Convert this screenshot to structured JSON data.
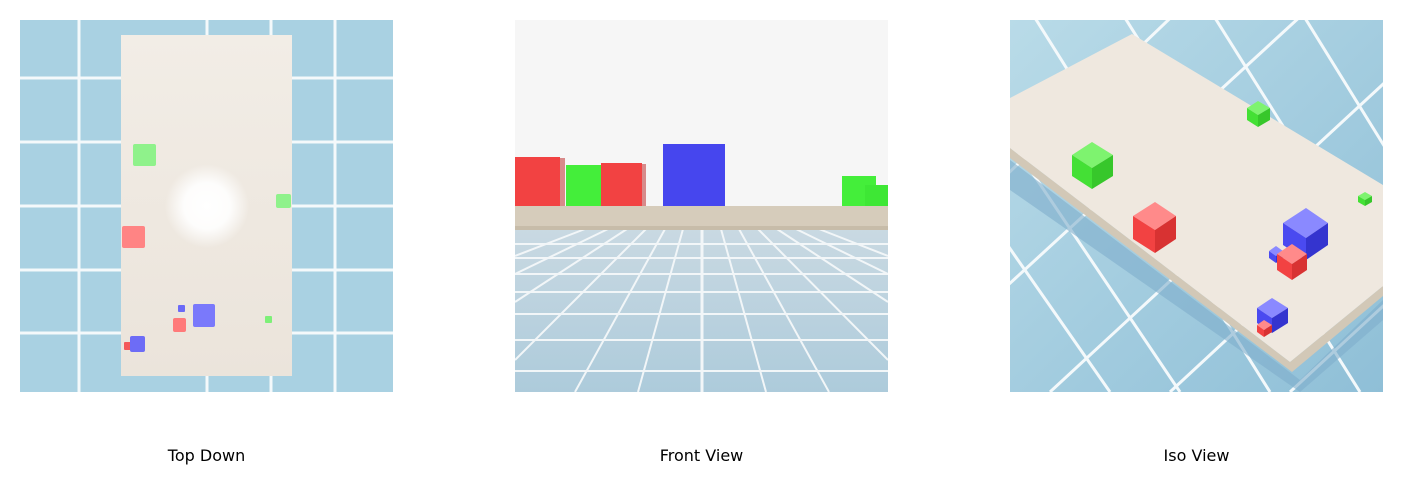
{
  "views": [
    {
      "caption": "Top Down"
    },
    {
      "caption": "Front View"
    },
    {
      "caption": "Iso View"
    }
  ],
  "colors": {
    "floor_tile": "#a9d1e2",
    "grout": "#f4f9fb",
    "table_top": "#efe8df",
    "table_edge": "#d8cebd",
    "sky": "#f6f6f6",
    "cube_red": "#f24242",
    "cube_green": "#44ee3a",
    "cube_blue": "#4646ee"
  }
}
